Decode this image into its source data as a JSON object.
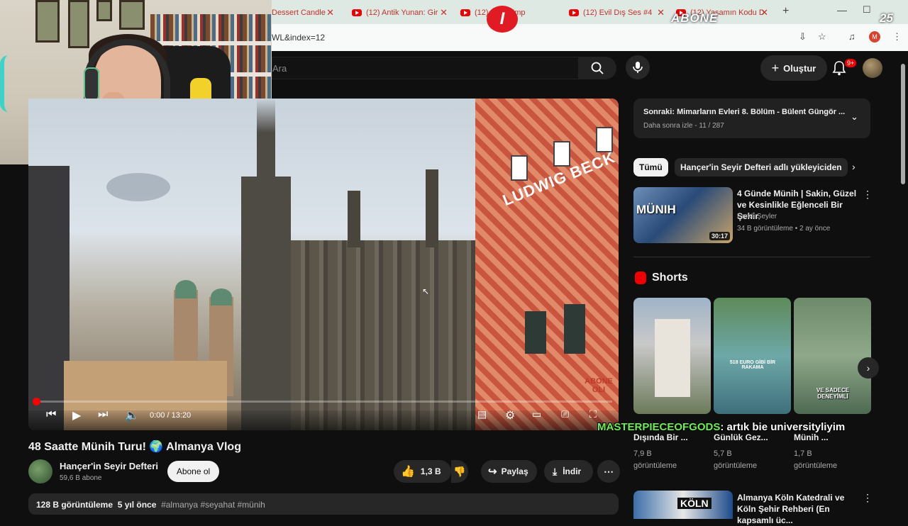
{
  "browser": {
    "tabs": [
      {
        "label": "Dessert Candle"
      },
      {
        "label": "(12) Antik Yunan: Gir"
      },
      {
        "label": "(12) ... eli Emp"
      },
      {
        "label": "(12) Evil Dış Ses #4"
      },
      {
        "label": "(12) Yaşamın Kodu D"
      }
    ],
    "new_tab": "+",
    "url": "WL&index=12"
  },
  "header": {
    "search_placeholder": "Ara",
    "create_label": "Oluştur",
    "notif_count": "9+"
  },
  "video": {
    "time": "0:00 / 13:20",
    "sign_text": "LUDWIG BECK",
    "corner_text": "ABONE OLI",
    "title": "48 Saatte Münih Turu! 🌍 Almanya Vlog",
    "channel": "Hançer'in Seyir Defteri",
    "subs": "59,6 B abone",
    "subscribe": "Abone ol",
    "likes": "1,3 B",
    "share": "Paylaş",
    "download": "İndir",
    "views": "128 B görüntüleme",
    "ago": "5 yıl önce",
    "tags": "#almanya #seyahat #münih"
  },
  "playlist": {
    "next_title": "Sonraki: Mimarların Evleri 8. Bölüm - Bülent Güngör ...",
    "next_sub": "Daha sonra izle - 11 / 287"
  },
  "chips": [
    {
      "label": "Tümü"
    },
    {
      "label": "Hançer'in Seyir Defteri adlı yükleyiciden"
    }
  ],
  "recommendations": [
    {
      "thumb_text": "MÜNIH",
      "duration": "30:17",
      "title": "4 Günde Münih | Sakin, Güzel ve Kesinlikle Eğlenceli Bir Şehir",
      "channel": "Farklı Şeyler",
      "meta": "34 B görüntüleme • 2 ay önce"
    },
    {
      "thumb_text": "KÖLN",
      "title": "Almanya Köln Katedrali ve Köln Şehir Rehberi (En kapsamlı üc..."
    }
  ],
  "shorts": {
    "label": "Shorts",
    "items": [
      {
        "title": "Dışında Bir ...",
        "views": "7,9 B",
        "views_unit": "görüntüleme",
        "overlay": ""
      },
      {
        "title": "Günlük Gez...",
        "views": "5,7 B",
        "views_unit": "görüntüleme",
        "overlay": "518 EURO GİBİ BİR RAKAMA"
      },
      {
        "title": "Münih ...",
        "views": "1,7 B",
        "views_unit": "görüntüleme",
        "overlay": "VE SADECE DENEYİMLİ"
      }
    ]
  },
  "overlay": {
    "chat_user": "MASTERPIECEOFGODS",
    "chat_msg": ": artık bie universityliyim",
    "abone_badge": "I",
    "abone_text": "ABONE",
    "stream_badge": "25"
  }
}
